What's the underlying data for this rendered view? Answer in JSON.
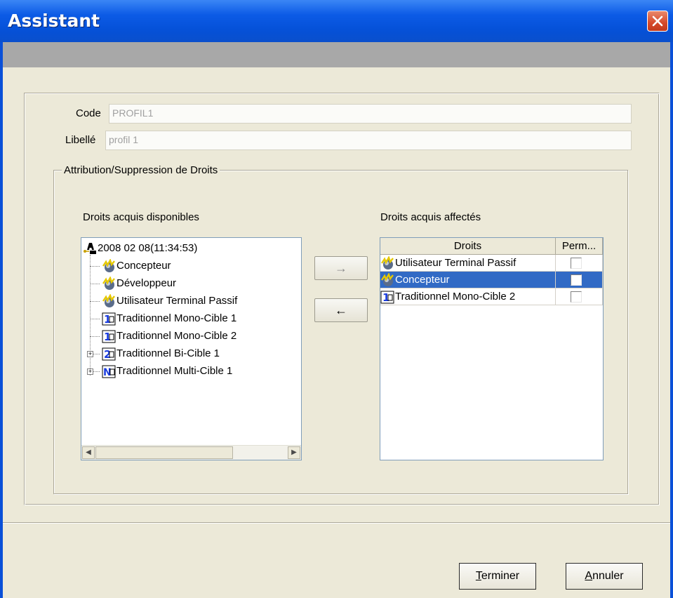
{
  "window": {
    "title": "Assistant"
  },
  "form": {
    "code_label": "Code",
    "code_value": "PROFIL1",
    "libelle_label": "Libellé",
    "libelle_value": "profil 1"
  },
  "group": {
    "title": "Attribution/Suppression de Droits"
  },
  "available": {
    "label": "Droits acquis disponibles",
    "root": "2008 02 08(11:34:53)",
    "items": [
      {
        "label": "Concepteur",
        "icon": "role-icon"
      },
      {
        "label": "Développeur",
        "icon": "role-icon"
      },
      {
        "label": "Utilisateur Terminal Passif",
        "icon": "role-icon"
      },
      {
        "label": "Traditionnel Mono-Cible 1",
        "icon": "mono-target-icon"
      },
      {
        "label": "Traditionnel Mono-Cible 2",
        "icon": "mono-target-icon"
      },
      {
        "label": "Traditionnel Bi-Cible 1",
        "icon": "bi-target-icon"
      },
      {
        "label": "Traditionnel Multi-Cible 1",
        "icon": "multi-target-icon"
      }
    ]
  },
  "move": {
    "add": "→",
    "remove": "←"
  },
  "assigned": {
    "label": "Droits acquis affectés",
    "columns": [
      "Droits",
      "Perm..."
    ],
    "rows": [
      {
        "label": "Utilisateur Terminal Passif",
        "icon": "role-icon",
        "perm": false,
        "selected": false
      },
      {
        "label": "Concepteur",
        "icon": "role-icon",
        "perm": false,
        "selected": true
      },
      {
        "label": "Traditionnel Mono-Cible 2",
        "icon": "mono-target-icon",
        "perm": false,
        "selected": false
      }
    ]
  },
  "buttons": {
    "finish_mnemonic": "T",
    "finish_rest": "erminer",
    "cancel_mnemonic": "A",
    "cancel_rest": "nnuler"
  },
  "colors": {
    "titlebar": "#0551d8",
    "selection": "#316ac5",
    "face": "#ece9d8"
  }
}
